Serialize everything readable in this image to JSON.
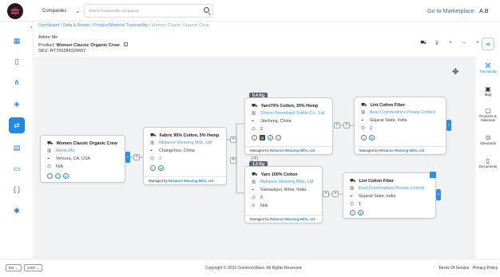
{
  "colors": {
    "accent": "#1f8be0",
    "link": "#4a9de0",
    "canvas": "#f1f2f4"
  },
  "topbar": {
    "companies_label": "Companies",
    "search_placeholder": "Search Sustainable companies",
    "marketplace_link": "Go to Marketplace",
    "user_initials": "A.B"
  },
  "sidebar": {
    "items": [
      "dashboard-icon",
      "document-icon",
      "network-icon",
      "assets-icon",
      "traceability-icon",
      "catalog-icon",
      "chat-icon",
      "brackets-icon",
      "settings-icon"
    ]
  },
  "breadcrumb": {
    "items": [
      "Dashboard",
      "Data & Assets",
      "Product/Material Traceability"
    ],
    "current": "Women Classic Organic Crew",
    "separator": " / "
  },
  "header": {
    "owner": "Adore Me",
    "product_label": "Product:",
    "product_name": "Women Classic Organic Crew",
    "sku_label": "SKU:",
    "sku_value": "RT783284329437"
  },
  "right_panel": {
    "items": [
      {
        "label": "Traceability",
        "icon": "traceability-icon",
        "active": true
      },
      {
        "label": "Map",
        "icon": "map-icon"
      },
      {
        "label": "Products & Materials",
        "icon": "box-icon"
      },
      {
        "label": "Standards",
        "icon": "standards-icon"
      },
      {
        "label": "Documents",
        "icon": "documents-icon"
      }
    ]
  },
  "nodes": {
    "product": {
      "title": "Women Classic Organic Crew",
      "company": "Adore Me",
      "location": "Ventura, CA, USA",
      "count": "N/A"
    },
    "fabric": {
      "title": "Fabric 95% Cotton, 5% Hemp",
      "company": "Reliance Weaving Mills, Ltd",
      "location": "Changzhou, China",
      "count": "3",
      "managed_label": "Managed by",
      "managed_by": "Reliance Weaving Mills, Ltd"
    },
    "yarn1": {
      "badge": "0.4 Kg",
      "title": "Yarn70% Cotton, 30% Hemp",
      "company": "Shanxi Greenland Textile Co., Ltd",
      "location": "Jincheng, China",
      "count": "2",
      "managed_label": "Managed by",
      "managed_by": "Reliance Weaving Mills, Ltd"
    },
    "yarn2": {
      "badge": "1.2 Kg",
      "title": "Yarn 100% Cotton",
      "company": "Reliance Weaving Mills, Ltd",
      "location": "Samastipur, Bihar, India",
      "count": "0",
      "extra": "N/A",
      "managed_label": "Managed by",
      "managed_by": "Reliance Weaving Mills, Ltd"
    },
    "fiber1": {
      "title": "Lint Cotton Fiber",
      "company": "Basil Commodities Private Limited",
      "location": "Gujarat State, India",
      "count": "1",
      "managed_label": "Managed by",
      "managed_by": "Reliance Weaving Mills, Ltd"
    },
    "fiber2": {
      "title": "Lint Cotton Fiber",
      "company": "Basil Commodities Private Limited",
      "location": "Gujarat State, India",
      "count": "1"
    }
  },
  "footer": {
    "language": "EN",
    "currency": "USD",
    "copyright": "Copyright © 2023 CommonShare. All Rights Reserved.",
    "terms": "Terms Of Service",
    "privacy": "Privacy Policy"
  }
}
